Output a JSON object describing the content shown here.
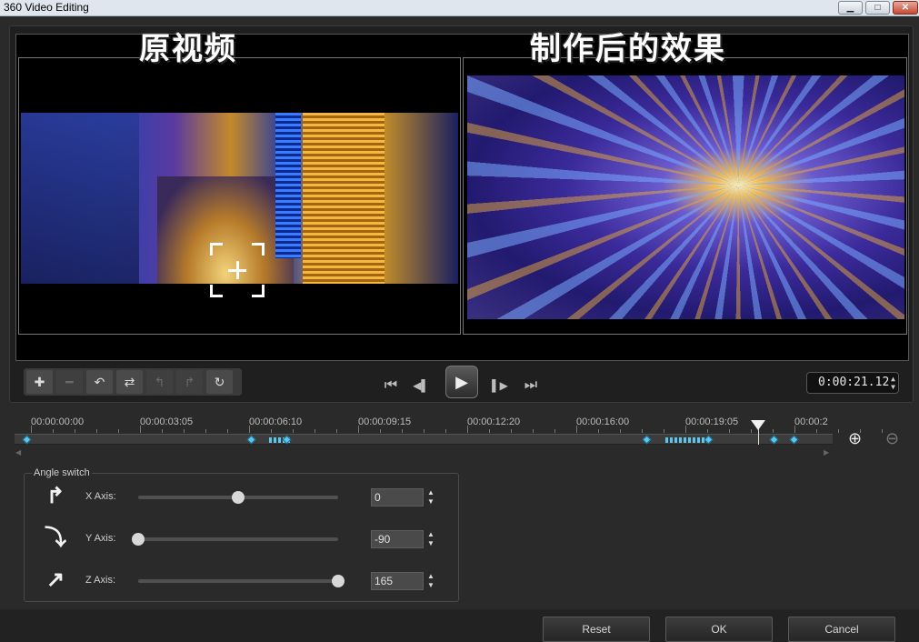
{
  "window": {
    "title": "360 Video Editing",
    "minimize_label": "▁",
    "maximize_label": "□",
    "close_label": "✕"
  },
  "preview": {
    "caption_original": "原视频",
    "caption_result": "制作后的效果"
  },
  "toolbar": {
    "buttons": [
      {
        "icon": "add-keyframe-icon",
        "glyph": "✚",
        "enabled": true
      },
      {
        "icon": "remove-keyframe-icon",
        "glyph": "━",
        "enabled": false
      },
      {
        "icon": "rotate-keyframe-icon",
        "glyph": "↶",
        "enabled": true
      },
      {
        "icon": "swap-keyframes-icon",
        "glyph": "⇄",
        "enabled": true
      },
      {
        "icon": "previous-keyframe-icon",
        "glyph": "↰",
        "enabled": false
      },
      {
        "icon": "next-keyframe-icon",
        "glyph": "↱",
        "enabled": false
      },
      {
        "icon": "reset-keyframe-icon",
        "glyph": "↻",
        "enabled": true
      }
    ]
  },
  "playback": {
    "go_start": "⏮",
    "step_back": "◀▌",
    "play": "▶",
    "step_forward": "▌▶",
    "go_end": "⏭",
    "timecode": "0:00:21.12"
  },
  "timeline": {
    "ticks": [
      "00:00:00:00",
      "00:00:03:05",
      "00:00:06:10",
      "00:00:09:15",
      "00:00:12:20",
      "00:00:16:00",
      "00:00:19:05",
      "00:00:2"
    ],
    "zoom_in_icon": "⊕",
    "zoom_out_icon": "⊖"
  },
  "angle_switch": {
    "title": "Angle switch",
    "axes": [
      {
        "label": "X Axis:",
        "value": "0",
        "level": 0.5,
        "icon": "x-axis-rotate-icon",
        "glyph": "↱"
      },
      {
        "label": "Y Axis:",
        "value": "-90",
        "level": 0.0,
        "icon": "y-axis-rotate-icon",
        "glyph": "⤵"
      },
      {
        "label": "Z Axis:",
        "value": "165",
        "level": 1.0,
        "icon": "z-axis-rotate-icon",
        "glyph": "↗"
      }
    ]
  },
  "footer": {
    "reset_label": "Reset",
    "ok_label": "OK",
    "cancel_label": "Cancel"
  },
  "colors": {
    "accent_keyframe": "#5cc8f0",
    "background": "#2a2a2a"
  }
}
